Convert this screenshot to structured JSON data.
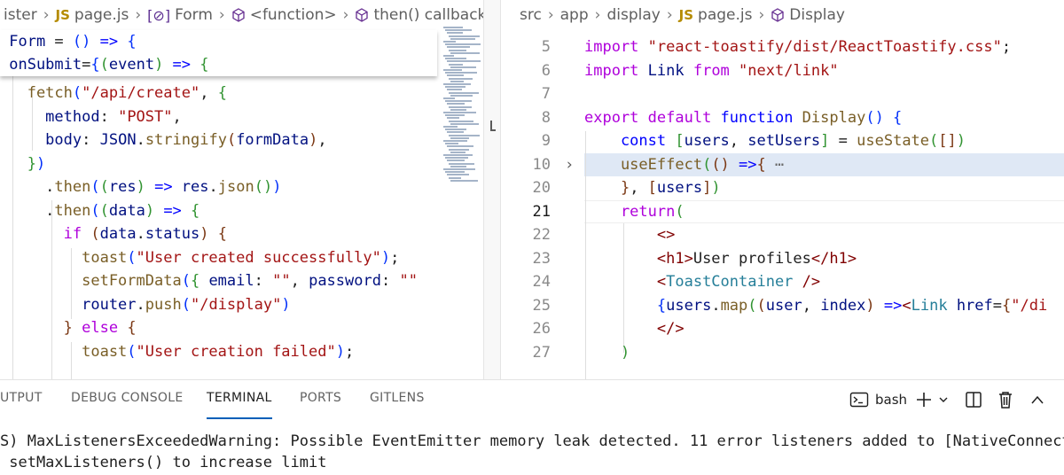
{
  "left_editor": {
    "breadcrumb": [
      "ister",
      "page.js",
      "Form",
      "<function>",
      "then() callback"
    ],
    "sticky_lines": [
      [
        {
          "t": " Form",
          "c": "var"
        },
        {
          "t": " = ",
          "c": "plain"
        },
        {
          "t": "()",
          "c": "br1"
        },
        {
          "t": " => ",
          "c": "kw"
        },
        {
          "t": "{",
          "c": "br1"
        }
      ],
      [
        {
          "t": " onSubmit",
          "c": "var"
        },
        {
          "t": "=",
          "c": "plain"
        },
        {
          "t": "{",
          "c": "br1"
        },
        {
          "t": "(",
          "c": "br2"
        },
        {
          "t": "event",
          "c": "var"
        },
        {
          "t": ")",
          "c": "br2"
        },
        {
          "t": " => ",
          "c": "kw"
        },
        {
          "t": "{",
          "c": "br2"
        }
      ]
    ],
    "lines": [
      [
        {
          "t": "   fetch",
          "c": "fn"
        },
        {
          "t": "(",
          "c": "br1"
        },
        {
          "t": "\"/api/create\"",
          "c": "str"
        },
        {
          "t": ", ",
          "c": "plain"
        },
        {
          "t": "{",
          "c": "br2"
        }
      ],
      [
        {
          "t": "     method",
          "c": "var"
        },
        {
          "t": ": ",
          "c": "plain"
        },
        {
          "t": "\"POST\"",
          "c": "str"
        },
        {
          "t": ",",
          "c": "plain"
        }
      ],
      [
        {
          "t": "     body",
          "c": "var"
        },
        {
          "t": ": ",
          "c": "plain"
        },
        {
          "t": "JSON",
          "c": "var"
        },
        {
          "t": ".",
          "c": "plain"
        },
        {
          "t": "stringify",
          "c": "fn"
        },
        {
          "t": "(",
          "c": "br3"
        },
        {
          "t": "formData",
          "c": "var"
        },
        {
          "t": ")",
          "c": "br3"
        },
        {
          "t": ",",
          "c": "plain"
        }
      ],
      [
        {
          "t": "   }",
          "c": "br2"
        },
        {
          "t": ")",
          "c": "br1"
        }
      ],
      [
        {
          "t": "     .",
          "c": "plain"
        },
        {
          "t": "then",
          "c": "fn"
        },
        {
          "t": "(",
          "c": "br1"
        },
        {
          "t": "(",
          "c": "br2"
        },
        {
          "t": "res",
          "c": "var"
        },
        {
          "t": ")",
          "c": "br2"
        },
        {
          "t": " => ",
          "c": "kw"
        },
        {
          "t": "res",
          "c": "var"
        },
        {
          "t": ".",
          "c": "plain"
        },
        {
          "t": "json",
          "c": "fn"
        },
        {
          "t": "()",
          "c": "br2"
        },
        {
          "t": ")",
          "c": "br1"
        }
      ],
      [
        {
          "t": "     .",
          "c": "plain"
        },
        {
          "t": "then",
          "c": "fn"
        },
        {
          "t": "(",
          "c": "br1"
        },
        {
          "t": "(",
          "c": "br2"
        },
        {
          "t": "data",
          "c": "var"
        },
        {
          "t": ")",
          "c": "br2"
        },
        {
          "t": " => ",
          "c": "kw"
        },
        {
          "t": "{",
          "c": "br2"
        }
      ],
      [
        {
          "t": "       if",
          "c": "ctrl"
        },
        {
          "t": " (",
          "c": "br3"
        },
        {
          "t": "data",
          "c": "var"
        },
        {
          "t": ".",
          "c": "plain"
        },
        {
          "t": "status",
          "c": "var"
        },
        {
          "t": ")",
          "c": "br3"
        },
        {
          "t": " {",
          "c": "br3"
        }
      ],
      [
        {
          "t": "         toast",
          "c": "fn"
        },
        {
          "t": "(",
          "c": "br1"
        },
        {
          "t": "\"User created successfully\"",
          "c": "str"
        },
        {
          "t": ")",
          "c": "br1"
        },
        {
          "t": ";",
          "c": "plain"
        }
      ],
      [
        {
          "t": "         setFormData",
          "c": "fn"
        },
        {
          "t": "(",
          "c": "br1"
        },
        {
          "t": "{",
          "c": "br2"
        },
        {
          "t": " email",
          "c": "var"
        },
        {
          "t": ": ",
          "c": "plain"
        },
        {
          "t": "\"\"",
          "c": "str"
        },
        {
          "t": ", ",
          "c": "plain"
        },
        {
          "t": "password",
          "c": "var"
        },
        {
          "t": ": ",
          "c": "plain"
        },
        {
          "t": "\"\"",
          "c": "str"
        }
      ],
      [
        {
          "t": "         router",
          "c": "var"
        },
        {
          "t": ".",
          "c": "plain"
        },
        {
          "t": "push",
          "c": "fn"
        },
        {
          "t": "(",
          "c": "br1"
        },
        {
          "t": "\"/display\"",
          "c": "str"
        },
        {
          "t": ")",
          "c": "br1"
        }
      ],
      [
        {
          "t": "       }",
          "c": "br3"
        },
        {
          "t": " else",
          "c": "ctrl"
        },
        {
          "t": " {",
          "c": "br3"
        }
      ],
      [
        {
          "t": "         toast",
          "c": "fn"
        },
        {
          "t": "(",
          "c": "br1"
        },
        {
          "t": "\"User creation failed\"",
          "c": "str"
        },
        {
          "t": ")",
          "c": "br1"
        },
        {
          "t": ";",
          "c": "plain"
        }
      ]
    ]
  },
  "right_editor": {
    "breadcrumb": [
      "src",
      "app",
      "display",
      "page.js",
      "Display"
    ],
    "line_numbers": [
      "5",
      "6",
      "7",
      "8",
      "9",
      "10",
      "20",
      "21",
      "22",
      "23",
      "24",
      "25",
      "26",
      "27"
    ],
    "active_line": "21",
    "lines": [
      [
        {
          "t": "import",
          "c": "ctrl"
        },
        {
          "t": " \"react-toastify/dist/ReactToastify.css\"",
          "c": "str"
        },
        {
          "t": ";",
          "c": "plain"
        }
      ],
      [
        {
          "t": "import",
          "c": "ctrl"
        },
        {
          "t": " Link",
          "c": "var"
        },
        {
          "t": " from",
          "c": "ctrl"
        },
        {
          "t": " \"next/link\"",
          "c": "str"
        }
      ],
      [],
      [
        {
          "t": "export",
          "c": "ctrl"
        },
        {
          "t": " default",
          "c": "ctrl"
        },
        {
          "t": " function",
          "c": "kw"
        },
        {
          "t": " Display",
          "c": "fn"
        },
        {
          "t": "()",
          "c": "br1"
        },
        {
          "t": " {",
          "c": "br1"
        }
      ],
      [
        {
          "t": "    const",
          "c": "kw"
        },
        {
          "t": " [",
          "c": "br2"
        },
        {
          "t": "users",
          "c": "var"
        },
        {
          "t": ", ",
          "c": "plain"
        },
        {
          "t": "setUsers",
          "c": "var"
        },
        {
          "t": "]",
          "c": "br2"
        },
        {
          "t": " = ",
          "c": "plain"
        },
        {
          "t": "useState",
          "c": "fn"
        },
        {
          "t": "(",
          "c": "br2"
        },
        {
          "t": "[]",
          "c": "br3"
        },
        {
          "t": ")",
          "c": "br2"
        }
      ],
      [
        {
          "t": "    useEffect",
          "c": "fn"
        },
        {
          "t": "(",
          "c": "br2"
        },
        {
          "t": "()",
          "c": "br3"
        },
        {
          "t": " =>",
          "c": "kw"
        },
        {
          "t": "{",
          "c": "br3"
        },
        {
          "t": " ⋯",
          "c": "ellipsis"
        }
      ],
      [
        {
          "t": "    }",
          "c": "br3"
        },
        {
          "t": ", ",
          "c": "plain"
        },
        {
          "t": "[",
          "c": "br3"
        },
        {
          "t": "users",
          "c": "var"
        },
        {
          "t": "]",
          "c": "br3"
        },
        {
          "t": ")",
          "c": "br2"
        }
      ],
      [
        {
          "t": "    return",
          "c": "ctrl"
        },
        {
          "t": "(",
          "c": "br2"
        }
      ],
      [
        {
          "t": "        <>",
          "c": "tag"
        }
      ],
      [
        {
          "t": "        <h1>",
          "c": "tag"
        },
        {
          "t": "User profiles",
          "c": "plain"
        },
        {
          "t": "</h1>",
          "c": "tag"
        }
      ],
      [
        {
          "t": "        <",
          "c": "tag"
        },
        {
          "t": "ToastContainer",
          "c": "cls"
        },
        {
          "t": " />",
          "c": "tag"
        }
      ],
      [
        {
          "t": "        {",
          "c": "br1"
        },
        {
          "t": "users",
          "c": "var"
        },
        {
          "t": ".",
          "c": "plain"
        },
        {
          "t": "map",
          "c": "fn"
        },
        {
          "t": "(",
          "c": "br2"
        },
        {
          "t": "(",
          "c": "br3"
        },
        {
          "t": "user",
          "c": "var"
        },
        {
          "t": ", ",
          "c": "plain"
        },
        {
          "t": "index",
          "c": "var"
        },
        {
          "t": ")",
          "c": "br3"
        },
        {
          "t": " =>",
          "c": "kw"
        },
        {
          "t": "<",
          "c": "tag"
        },
        {
          "t": "Link",
          "c": "cls"
        },
        {
          "t": " href",
          "c": "var"
        },
        {
          "t": "=",
          "c": "plain"
        },
        {
          "t": "{",
          "c": "br3"
        },
        {
          "t": "\"/di",
          "c": "str"
        }
      ],
      [
        {
          "t": "        </>",
          "c": "tag"
        }
      ],
      [
        {
          "t": "    )",
          "c": "br2"
        }
      ]
    ]
  },
  "panel": {
    "tabs": [
      "UTPUT",
      "DEBUG CONSOLE",
      "TERMINAL",
      "PORTS",
      "GITLENS"
    ],
    "active_tab": "TERMINAL",
    "shell_label": "bash",
    "terminal_lines": [
      "S) MaxListenersExceededWarning: Possible EventEmitter memory leak detected. 11 error listeners added to [NativeConnectio",
      " setMaxListeners() to increase limit"
    ]
  },
  "colors": {
    "active_tab_underline": "#005fb8",
    "fold_highlight": "#dfe8f5"
  }
}
